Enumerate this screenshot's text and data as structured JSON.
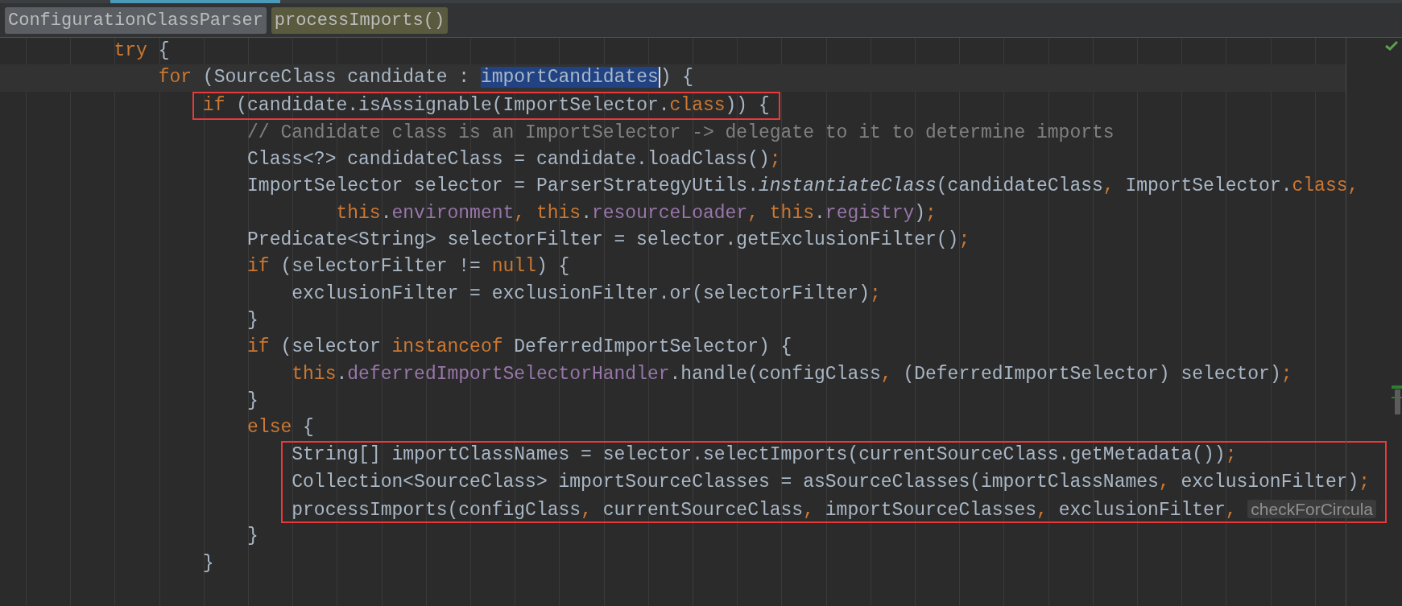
{
  "breadcrumbs": [
    {
      "label": "ConfigurationClassParser",
      "kind": "class"
    },
    {
      "label": "processImports()",
      "kind": "method"
    }
  ],
  "lines": [
    {
      "current": false,
      "boxed": false,
      "tokens": [
        {
          "kind": "kw",
          "text": "        try"
        },
        {
          "kind": "plain",
          "text": " {"
        }
      ]
    },
    {
      "current": true,
      "boxed": false,
      "tokens": [
        {
          "kind": "kw",
          "text": "            for"
        },
        {
          "kind": "plain",
          "text": " (SourceClass candidate : "
        },
        {
          "kind": "selected",
          "text": "importCandidates"
        },
        {
          "kind": "plain",
          "text": ") {"
        }
      ]
    },
    {
      "current": false,
      "boxed": true,
      "tokens": [
        {
          "kind": "kw",
          "text": "                if"
        },
        {
          "kind": "plain",
          "text": " (candidate.isAssignable(ImportSelector."
        },
        {
          "kind": "kw",
          "text": "class"
        },
        {
          "kind": "plain",
          "text": ")) {"
        }
      ]
    },
    {
      "current": false,
      "boxed": false,
      "tokens": [
        {
          "kind": "comment",
          "text": "                    // Candidate class is an ImportSelector -> delegate to it to determine imports"
        }
      ]
    },
    {
      "current": false,
      "boxed": false,
      "tokens": [
        {
          "kind": "plain",
          "text": "                    Class<?> candidateClass = candidate.loadClass()"
        },
        {
          "kind": "kw",
          "text": ";"
        }
      ]
    },
    {
      "current": false,
      "boxed": false,
      "tokens": [
        {
          "kind": "plain",
          "text": "                    ImportSelector selector = ParserStrategyUtils."
        },
        {
          "kind": "italic",
          "text": "instantiateClass"
        },
        {
          "kind": "plain",
          "text": "(candidateClass"
        },
        {
          "kind": "kw",
          "text": ", "
        },
        {
          "kind": "plain",
          "text": "ImportSelector."
        },
        {
          "kind": "kw",
          "text": "class,"
        }
      ]
    },
    {
      "current": false,
      "boxed": false,
      "tokens": [
        {
          "kind": "kw",
          "text": "                            this"
        },
        {
          "kind": "plain",
          "text": "."
        },
        {
          "kind": "field",
          "text": "environment"
        },
        {
          "kind": "kw",
          "text": ", this"
        },
        {
          "kind": "plain",
          "text": "."
        },
        {
          "kind": "field",
          "text": "resourceLoader"
        },
        {
          "kind": "kw",
          "text": ", this"
        },
        {
          "kind": "plain",
          "text": "."
        },
        {
          "kind": "field",
          "text": "registry"
        },
        {
          "kind": "plain",
          "text": ")"
        },
        {
          "kind": "kw",
          "text": ";"
        }
      ]
    },
    {
      "current": false,
      "boxed": false,
      "tokens": [
        {
          "kind": "plain",
          "text": "                    Predicate<String> selectorFilter = selector.getExclusionFilter()"
        },
        {
          "kind": "kw",
          "text": ";"
        }
      ]
    },
    {
      "current": false,
      "boxed": false,
      "tokens": [
        {
          "kind": "kw",
          "text": "                    if"
        },
        {
          "kind": "plain",
          "text": " (selectorFilter != "
        },
        {
          "kind": "kw",
          "text": "null"
        },
        {
          "kind": "plain",
          "text": ") {"
        }
      ]
    },
    {
      "current": false,
      "boxed": false,
      "tokens": [
        {
          "kind": "plain",
          "text": "                        exclusionFilter = exclusionFilter.or(selectorFilter)"
        },
        {
          "kind": "kw",
          "text": ";"
        }
      ]
    },
    {
      "current": false,
      "boxed": false,
      "tokens": [
        {
          "kind": "plain",
          "text": "                    }"
        }
      ]
    },
    {
      "current": false,
      "boxed": false,
      "tokens": [
        {
          "kind": "kw",
          "text": "                    if"
        },
        {
          "kind": "plain",
          "text": " (selector "
        },
        {
          "kind": "kw",
          "text": "instanceof"
        },
        {
          "kind": "plain",
          "text": " DeferredImportSelector) {"
        }
      ]
    },
    {
      "current": false,
      "boxed": false,
      "tokens": [
        {
          "kind": "kw",
          "text": "                        this"
        },
        {
          "kind": "plain",
          "text": "."
        },
        {
          "kind": "field",
          "text": "deferredImportSelectorHandler"
        },
        {
          "kind": "plain",
          "text": ".handle(configClass"
        },
        {
          "kind": "kw",
          "text": ", "
        },
        {
          "kind": "plain",
          "text": "(DeferredImportSelector) selector)"
        },
        {
          "kind": "kw",
          "text": ";"
        }
      ]
    },
    {
      "current": false,
      "boxed": false,
      "tokens": [
        {
          "kind": "plain",
          "text": "                    }"
        }
      ]
    },
    {
      "current": false,
      "boxed": false,
      "tokens": [
        {
          "kind": "kw",
          "text": "                    else"
        },
        {
          "kind": "plain",
          "text": " {"
        }
      ]
    },
    {
      "current": false,
      "boxed": true,
      "tokens": [
        {
          "kind": "plain",
          "text": "                        String[] importClassNames = selector.selectImports(currentSourceClass.getMetadata())"
        },
        {
          "kind": "kw",
          "text": ";"
        }
      ]
    },
    {
      "current": false,
      "boxed": true,
      "tokens": [
        {
          "kind": "plain",
          "text": "                        Collection<SourceClass> importSourceClasses = asSourceClasses(importClassNames"
        },
        {
          "kind": "kw",
          "text": ", "
        },
        {
          "kind": "plain",
          "text": "exclusionFilter)"
        },
        {
          "kind": "kw",
          "text": ";"
        }
      ]
    },
    {
      "current": false,
      "boxed": true,
      "tokens": [
        {
          "kind": "plain",
          "text": "                        processImports(configClass"
        },
        {
          "kind": "kw",
          "text": ", "
        },
        {
          "kind": "plain",
          "text": "currentSourceClass"
        },
        {
          "kind": "kw",
          "text": ", "
        },
        {
          "kind": "plain",
          "text": "importSourceClasses"
        },
        {
          "kind": "kw",
          "text": ", "
        },
        {
          "kind": "plain",
          "text": "exclusionFilter"
        },
        {
          "kind": "kw",
          "text": ", "
        },
        {
          "kind": "hint",
          "text": "checkForCircula"
        }
      ]
    },
    {
      "current": false,
      "boxed": false,
      "tokens": [
        {
          "kind": "plain",
          "text": "                    }"
        }
      ]
    },
    {
      "current": false,
      "boxed": false,
      "tokens": [
        {
          "kind": "plain",
          "text": "                }"
        }
      ]
    }
  ]
}
